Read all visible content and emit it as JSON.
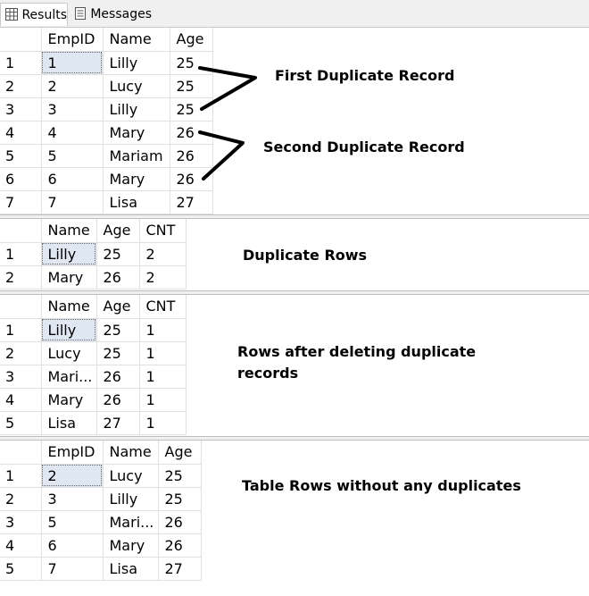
{
  "tabs": [
    {
      "label": "Results",
      "icon": "grid-icon"
    },
    {
      "label": "Messages",
      "icon": "messages-icon"
    }
  ],
  "grid1": {
    "columns": [
      "EmpID",
      "Name",
      "Age"
    ],
    "rows": [
      [
        "1",
        "1",
        "Lilly",
        "25"
      ],
      [
        "2",
        "2",
        "Lucy",
        "25"
      ],
      [
        "3",
        "3",
        "Lilly",
        "25"
      ],
      [
        "4",
        "4",
        "Mary",
        "26"
      ],
      [
        "5",
        "5",
        "Mariam",
        "26"
      ],
      [
        "6",
        "6",
        "Mary",
        "26"
      ],
      [
        "7",
        "7",
        "Lisa",
        "27"
      ]
    ]
  },
  "grid2": {
    "columns": [
      "Name",
      "Age",
      "CNT"
    ],
    "rows": [
      [
        "1",
        "Lilly",
        "25",
        "2"
      ],
      [
        "2",
        "Mary",
        "26",
        "2"
      ]
    ]
  },
  "grid3": {
    "columns": [
      "Name",
      "Age",
      "CNT"
    ],
    "rows": [
      [
        "1",
        "Lilly",
        "25",
        "1"
      ],
      [
        "2",
        "Lucy",
        "25",
        "1"
      ],
      [
        "3",
        "Mari...",
        "26",
        "1"
      ],
      [
        "4",
        "Mary",
        "26",
        "1"
      ],
      [
        "5",
        "Lisa",
        "27",
        "1"
      ]
    ]
  },
  "grid4": {
    "columns": [
      "EmpID",
      "Name",
      "Age"
    ],
    "rows": [
      [
        "1",
        "2",
        "Lucy",
        "25"
      ],
      [
        "2",
        "3",
        "Lilly",
        "25"
      ],
      [
        "3",
        "5",
        "Mari...",
        "26"
      ],
      [
        "4",
        "6",
        "Mary",
        "26"
      ],
      [
        "5",
        "7",
        "Lisa",
        "27"
      ]
    ]
  },
  "annotations": {
    "first_duplicate": "First Duplicate Record",
    "second_duplicate": "Second Duplicate Record",
    "duplicate_rows": "Duplicate Rows",
    "rows_after_line1": "Rows after deleting duplicate",
    "rows_after_line2": "records",
    "table_rows_clean": "Table Rows without any duplicates"
  }
}
